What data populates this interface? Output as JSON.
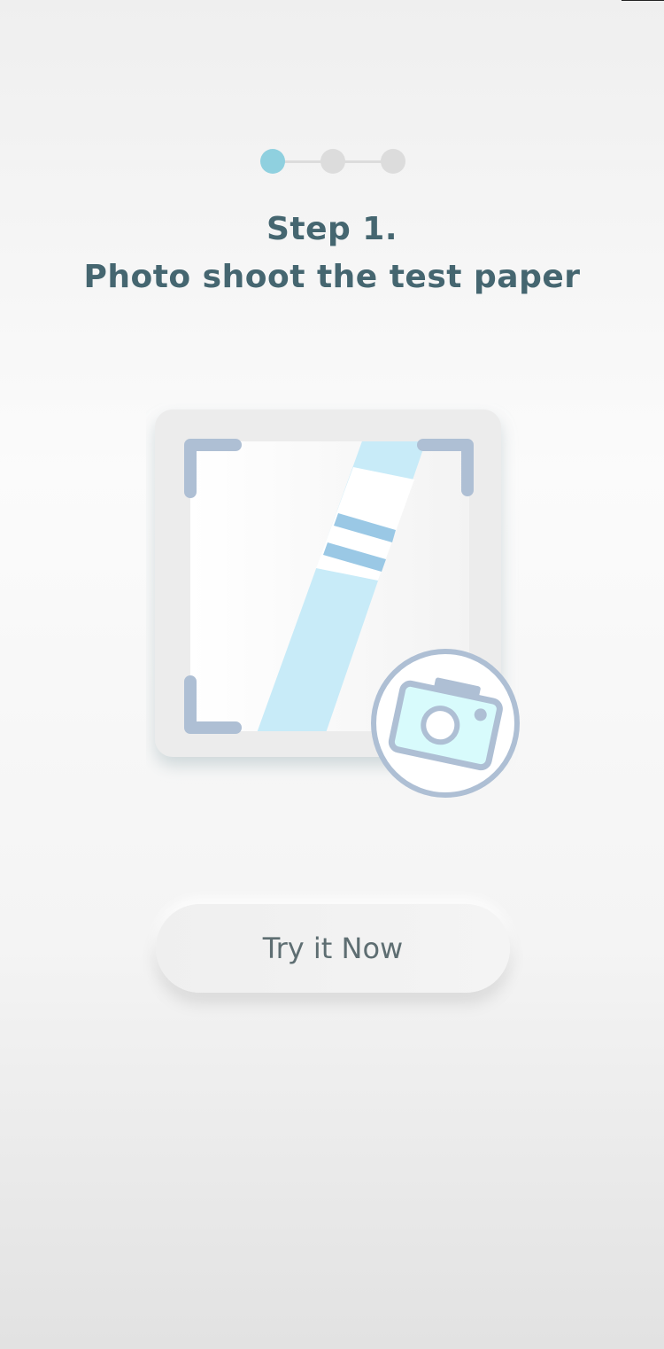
{
  "stepper": {
    "current_step": 1,
    "total_steps": 3,
    "active_color": "#8fd0df",
    "inactive_color": "#dcdcdc"
  },
  "header": {
    "title_line1": "Step 1.",
    "title_line2": "Photo shoot the test paper",
    "title_color": "#456670"
  },
  "illustration": {
    "icons": [
      "scan-frame-icon",
      "test-strip-icon",
      "camera-icon"
    ]
  },
  "actions": {
    "cta_label": "Try it Now"
  }
}
